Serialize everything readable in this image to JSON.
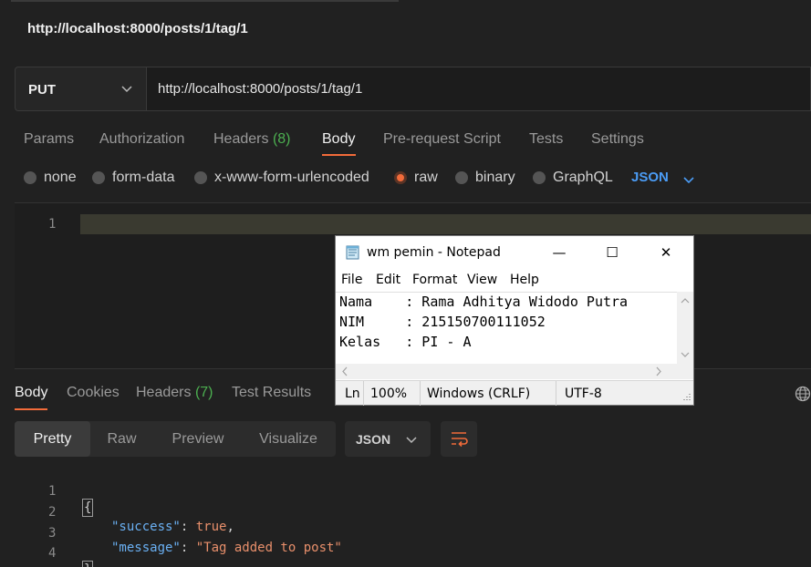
{
  "window": {
    "title": "http://localhost:8000/posts/1/tag/1"
  },
  "request": {
    "method": "PUT",
    "url": "http://localhost:8000/posts/1/tag/1"
  },
  "request_tabs": {
    "params": "Params",
    "authorization": "Authorization",
    "headers": "Headers",
    "headers_count": "(8)",
    "body": "Body",
    "prerequest": "Pre-request Script",
    "tests": "Tests",
    "settings": "Settings"
  },
  "body_types": {
    "none": "none",
    "form_data": "form-data",
    "urlencoded": "x-www-form-urlencoded",
    "raw": "raw",
    "binary": "binary",
    "graphql": "GraphQL",
    "format": "JSON",
    "selected": "raw"
  },
  "editor": {
    "line_number": "1"
  },
  "response_tabs": {
    "body": "Body",
    "cookies": "Cookies",
    "headers": "Headers",
    "headers_count": "(7)",
    "test_results": "Test Results"
  },
  "view_modes": {
    "pretty": "Pretty",
    "raw": "Raw",
    "preview": "Preview",
    "visualize": "Visualize",
    "format": "JSON"
  },
  "response_body": {
    "lines": [
      {
        "num": "1",
        "open": "{"
      },
      {
        "num": "2",
        "key": "\"success\"",
        "colon": ": ",
        "value": "true",
        "comma": ","
      },
      {
        "num": "3",
        "key": "\"message\"",
        "colon": ": ",
        "value": "\"Tag added to post\""
      },
      {
        "num": "4",
        "close": "}"
      }
    ]
  },
  "notepad": {
    "title": "wm pemin - Notepad",
    "minimize": "—",
    "maximize": "☐",
    "close": "✕",
    "menu": {
      "file": "File",
      "edit": "Edit",
      "format": "Format",
      "view": "View",
      "help": "Help"
    },
    "lines": [
      "Nama    : Rama Adhitya Widodo Putra",
      "NIM     : 215150700111052",
      "Kelas   : PI - A"
    ],
    "status": {
      "ln": "Ln",
      "zoom": "100%",
      "eol": "Windows (CRLF)",
      "encoding": "UTF-8"
    }
  },
  "colors": {
    "accent": "#f26b3a",
    "count_green": "#4caf50",
    "json_blue": "#4b9cf5"
  }
}
